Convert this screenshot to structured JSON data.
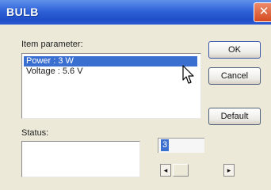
{
  "window": {
    "title": "BULB"
  },
  "labels": {
    "item_parameter": "Item parameter:",
    "status": "Status:"
  },
  "parameters": [
    {
      "text": "Power : 3 W",
      "selected": true
    },
    {
      "text": "Voltage : 5.6 V",
      "selected": false
    }
  ],
  "buttons": {
    "ok": "OK",
    "cancel": "Cancel",
    "default": "Default"
  },
  "value_field": {
    "value": "3"
  },
  "slider": {
    "left_arrow": "◂",
    "right_arrow": "▸"
  },
  "icons": {
    "close": "close-icon",
    "cursor": "mouse-pointer-icon"
  },
  "colors": {
    "titlebar": "#2f62d8",
    "selection": "#3a6fd0",
    "close_button": "#d44a20"
  }
}
